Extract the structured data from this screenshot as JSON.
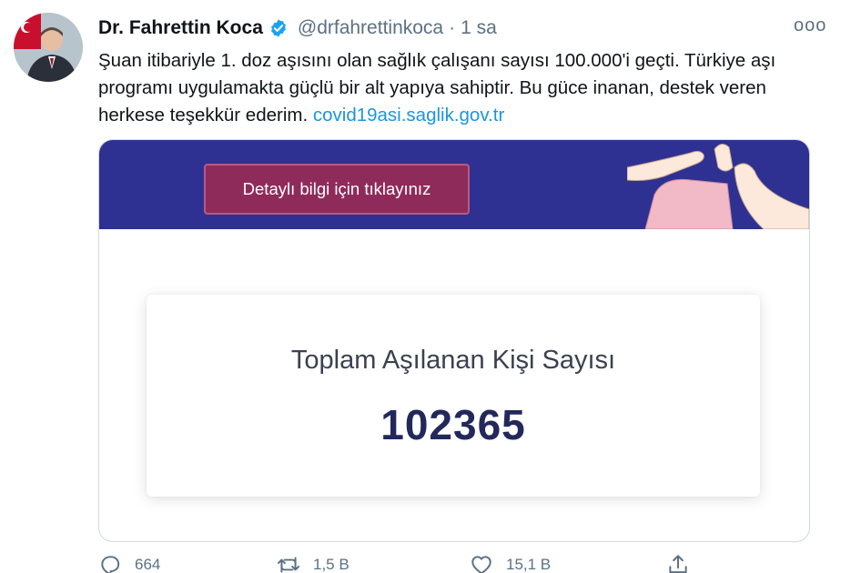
{
  "tweet": {
    "display_name": "Dr. Fahrettin Koca",
    "handle": "@drfahrettinkoca",
    "separator": "·",
    "time": "1 sa",
    "more_label": "ooo",
    "text_main": "Şuan itibariyle 1. doz aşısını olan sağlık çalışanı sayısı 100.000'i geçti. Türkiye aşı programı uygulamakta güçlü bir alt yapıya sahiptir. Bu güce inanan, destek veren herkese teşekkür ederim.",
    "link_text": "covid19asi.saglik.gov.tr"
  },
  "card": {
    "button_label": "Detaylı bilgi için tıklayınız",
    "stat_label": "Toplam Aşılanan Kişi Sayısı",
    "stat_value": "102365"
  },
  "actions": {
    "reply_count": "664",
    "retweet_count": "1,5 B",
    "like_count": "15,1 B"
  },
  "icons": {
    "verified": "verified-badge-icon",
    "more": "more-options-icon",
    "reply": "reply-icon",
    "retweet": "retweet-icon",
    "like": "heart-icon",
    "share": "share-icon"
  },
  "colors": {
    "accent_link": "#1b95e0",
    "banner": "#2e3192",
    "button": "#8f2b5a",
    "stat_value": "#23285c",
    "muted": "#5b7083"
  }
}
